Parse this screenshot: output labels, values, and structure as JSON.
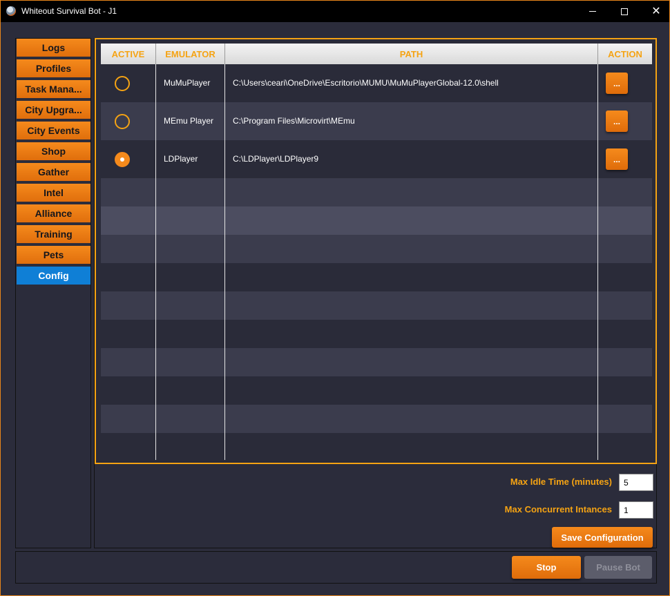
{
  "window": {
    "title": "Whiteout Survival Bot - J1",
    "controls": {
      "minimize": "—",
      "maximize": "☐",
      "close": "✕"
    }
  },
  "sidebar": {
    "items": [
      {
        "label": "Logs",
        "active": false
      },
      {
        "label": "Profiles",
        "active": false
      },
      {
        "label": "Task Mana...",
        "active": false
      },
      {
        "label": "City Upgra...",
        "active": false
      },
      {
        "label": "City Events",
        "active": false
      },
      {
        "label": "Shop",
        "active": false
      },
      {
        "label": "Gather",
        "active": false
      },
      {
        "label": "Intel",
        "active": false
      },
      {
        "label": "Alliance",
        "active": false
      },
      {
        "label": "Training",
        "active": false
      },
      {
        "label": "Pets",
        "active": false
      },
      {
        "label": "Config",
        "active": true
      }
    ]
  },
  "table": {
    "headers": {
      "active": "ACTIVE",
      "emulator": "EMULATOR",
      "path": "PATH",
      "action": "ACTION"
    },
    "rows": [
      {
        "active": false,
        "emulator": "MuMuPlayer",
        "path": "C:\\Users\\ceari\\OneDrive\\Escritorio\\MUMU\\MuMuPlayerGlobal-12.0\\shell",
        "action": "..."
      },
      {
        "active": false,
        "emulator": "MEmu Player",
        "path": "C:\\Program Files\\Microvirt\\MEmu",
        "action": "..."
      },
      {
        "active": true,
        "emulator": "LDPlayer",
        "path": "C:\\LDPlayer\\LDPlayer9",
        "action": "..."
      }
    ]
  },
  "config": {
    "max_idle_label": "Max Idle Time (minutes)",
    "max_idle_value": "5",
    "max_concurrent_label": "Max Concurrent Intances",
    "max_concurrent_value": "1",
    "save_label": "Save Configuration"
  },
  "footer": {
    "stop_label": "Stop",
    "pause_label": "Pause Bot"
  },
  "colors": {
    "accent": "#f58a1c",
    "header_text": "#f5a313",
    "active_tab": "#0f7fd6",
    "background": "#2b2c3b"
  },
  "icons": [
    "app-icon",
    "minimize-icon",
    "maximize-icon",
    "close-icon"
  ]
}
